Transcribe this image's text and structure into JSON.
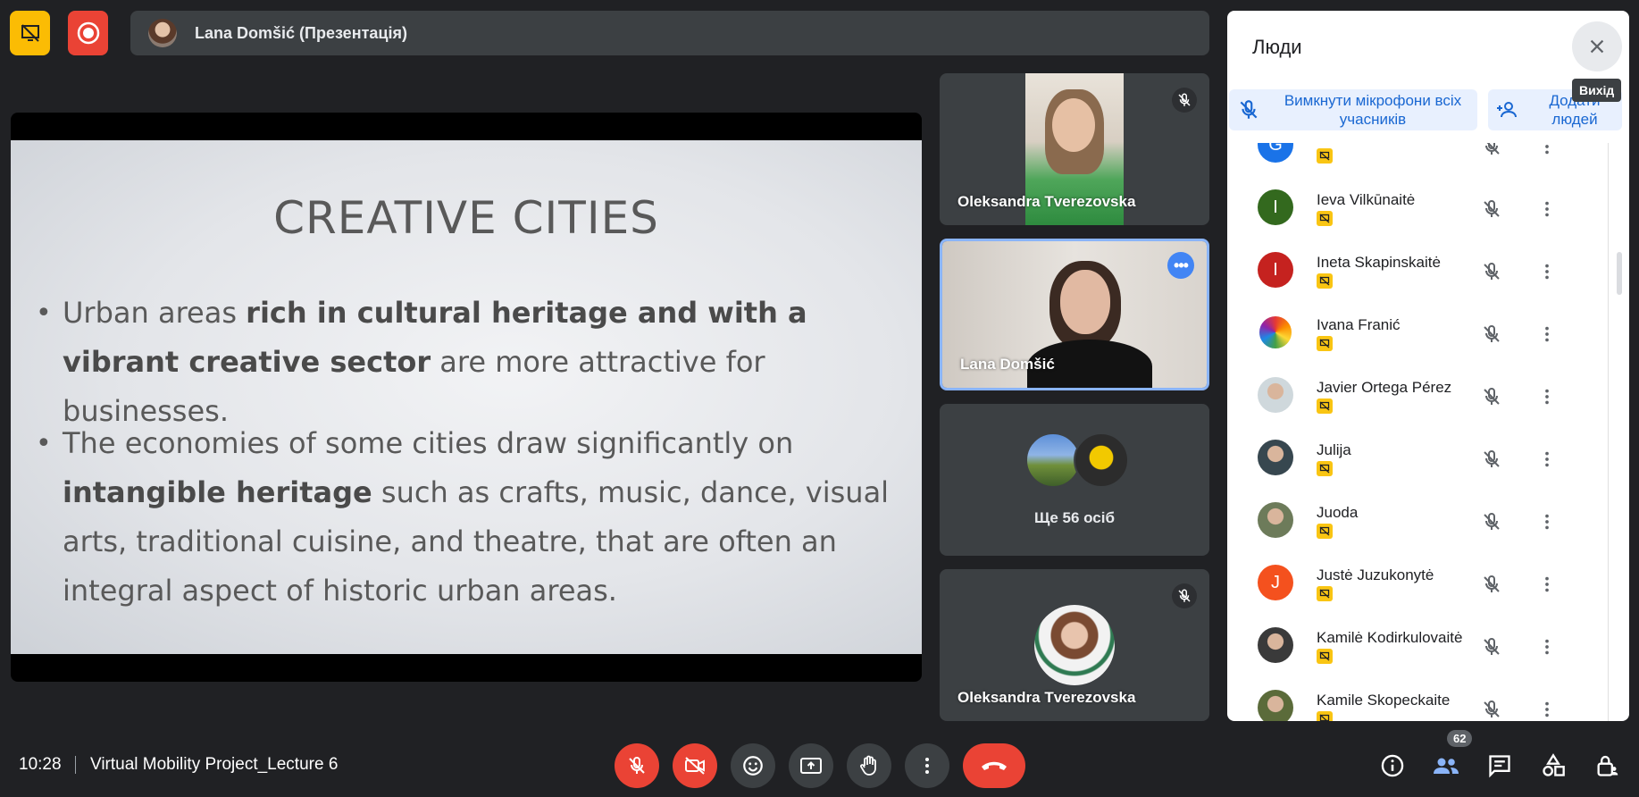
{
  "presenter_bar": {
    "name": "Lana Domšić (Презентація)"
  },
  "slide": {
    "title": "CREATIVE CITIES",
    "bullet1": {
      "p1": "Urban areas ",
      "bold1": "rich in cultural heritage and with a vibrant creative sector",
      "p2": " are more attractive for businesses."
    },
    "bullet2": {
      "p1": "The economies of some cities draw significantly on ",
      "bold1": "intangible heritage",
      "p2": " such as crafts, music, dance, visual arts, traditional cuisine, and theatre, that are often an integral aspect of historic urban areas."
    }
  },
  "tiles": {
    "tile1_name": "Oleksandra Tverezovska",
    "tile2_name": "Lana Domšić",
    "tile3_more": "Ще 56 осіб",
    "tile4_name": "Oleksandra Tverezovska"
  },
  "panel": {
    "title": "Люди",
    "close_tooltip": "Вихід",
    "mute_all": "Вимкнути мікрофони всіх учасників",
    "add_people": "Додати людей",
    "people": [
      {
        "name": "",
        "initial": "G",
        "color": "#1a73e8"
      },
      {
        "name": "Ieva Vilkūnaitė",
        "initial": "I",
        "color": "#33691e"
      },
      {
        "name": "Ineta Skapinskaitė",
        "initial": "I",
        "color": "#c5221f"
      },
      {
        "name": "Ivana Franić",
        "initial": "",
        "color": "#ffffff"
      },
      {
        "name": "Javier Ortega Pérez",
        "initial": "",
        "color": "#cfd8dc"
      },
      {
        "name": "Julija",
        "initial": "",
        "color": "#37474f"
      },
      {
        "name": "Juoda",
        "initial": "",
        "color": "#6d7b5a"
      },
      {
        "name": "Justė Juzukonytė",
        "initial": "J",
        "color": "#f4511e"
      },
      {
        "name": "Kamilė Kodirkulovaitė",
        "initial": "",
        "color": "#3a3a3a"
      },
      {
        "name": "Kamile Skopeckaite",
        "initial": "",
        "color": "#5b6b3a"
      }
    ]
  },
  "bottom": {
    "time": "10:28",
    "meeting_title": "Virtual Mobility Project_Lecture 6",
    "participant_count": "62"
  },
  "colors": {
    "accent_red": "#ea4335",
    "accent_yellow": "#fbbc04",
    "accent_blue": "#8ab4f8"
  }
}
